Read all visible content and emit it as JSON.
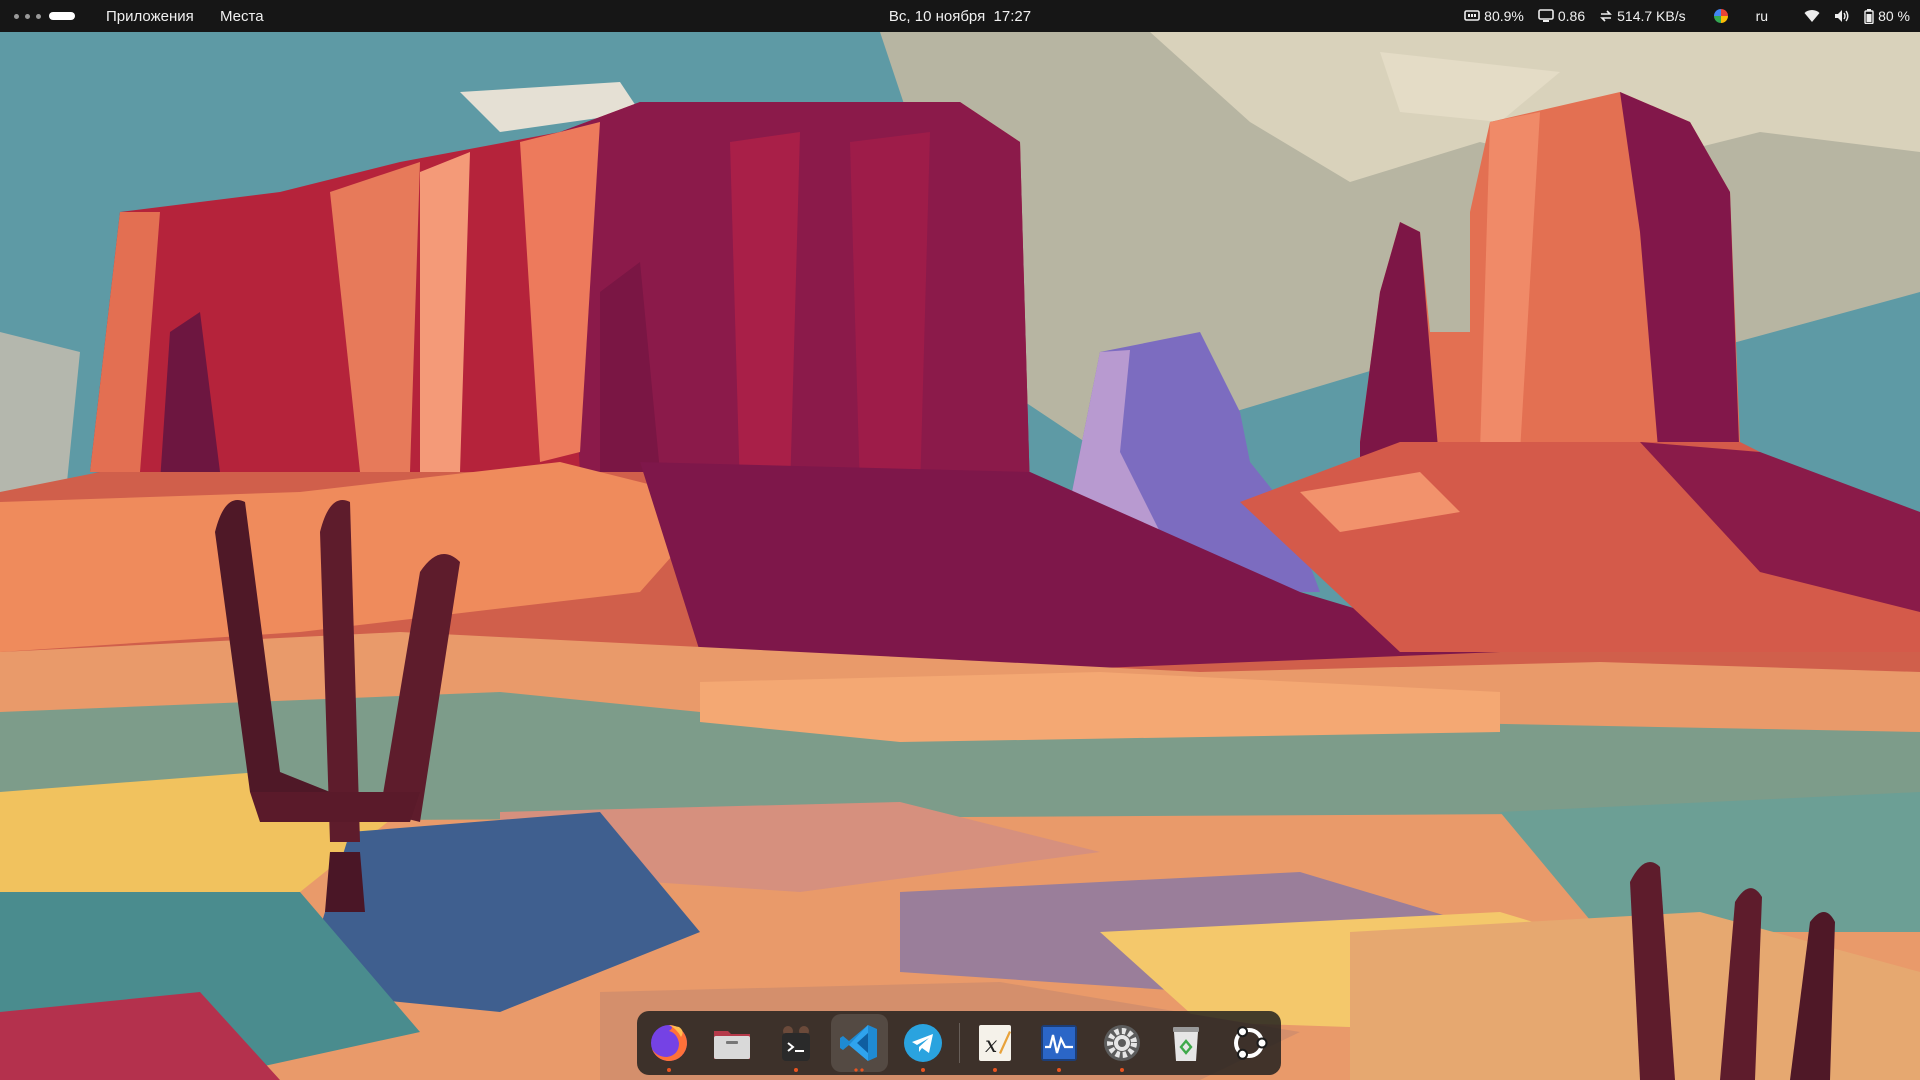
{
  "topbar": {
    "menu_apps": "Приложения",
    "menu_places": "Места",
    "clock": "Вс, 10 ноября  17:27",
    "cpu": "80.9%",
    "load": "0.86",
    "net": "514.7 KB/s",
    "lang": "ru",
    "battery": "80 %"
  },
  "dock": {
    "items": [
      {
        "name": "firefox",
        "running": true
      },
      {
        "name": "files",
        "running": false
      },
      {
        "name": "terminal",
        "running": true
      },
      {
        "name": "vscode",
        "running": true
      },
      {
        "name": "telegram",
        "running": true
      },
      {
        "name": "xournal",
        "running": true
      },
      {
        "name": "system-monitor",
        "running": true
      },
      {
        "name": "settings",
        "running": true
      },
      {
        "name": "trash",
        "running": false
      },
      {
        "name": "show-apps",
        "running": false
      }
    ]
  },
  "colors": {
    "topbar_bg": "#161616",
    "accent": "#e95420",
    "sky": "#5e9aa5",
    "cloud": "#d9d2bb"
  }
}
